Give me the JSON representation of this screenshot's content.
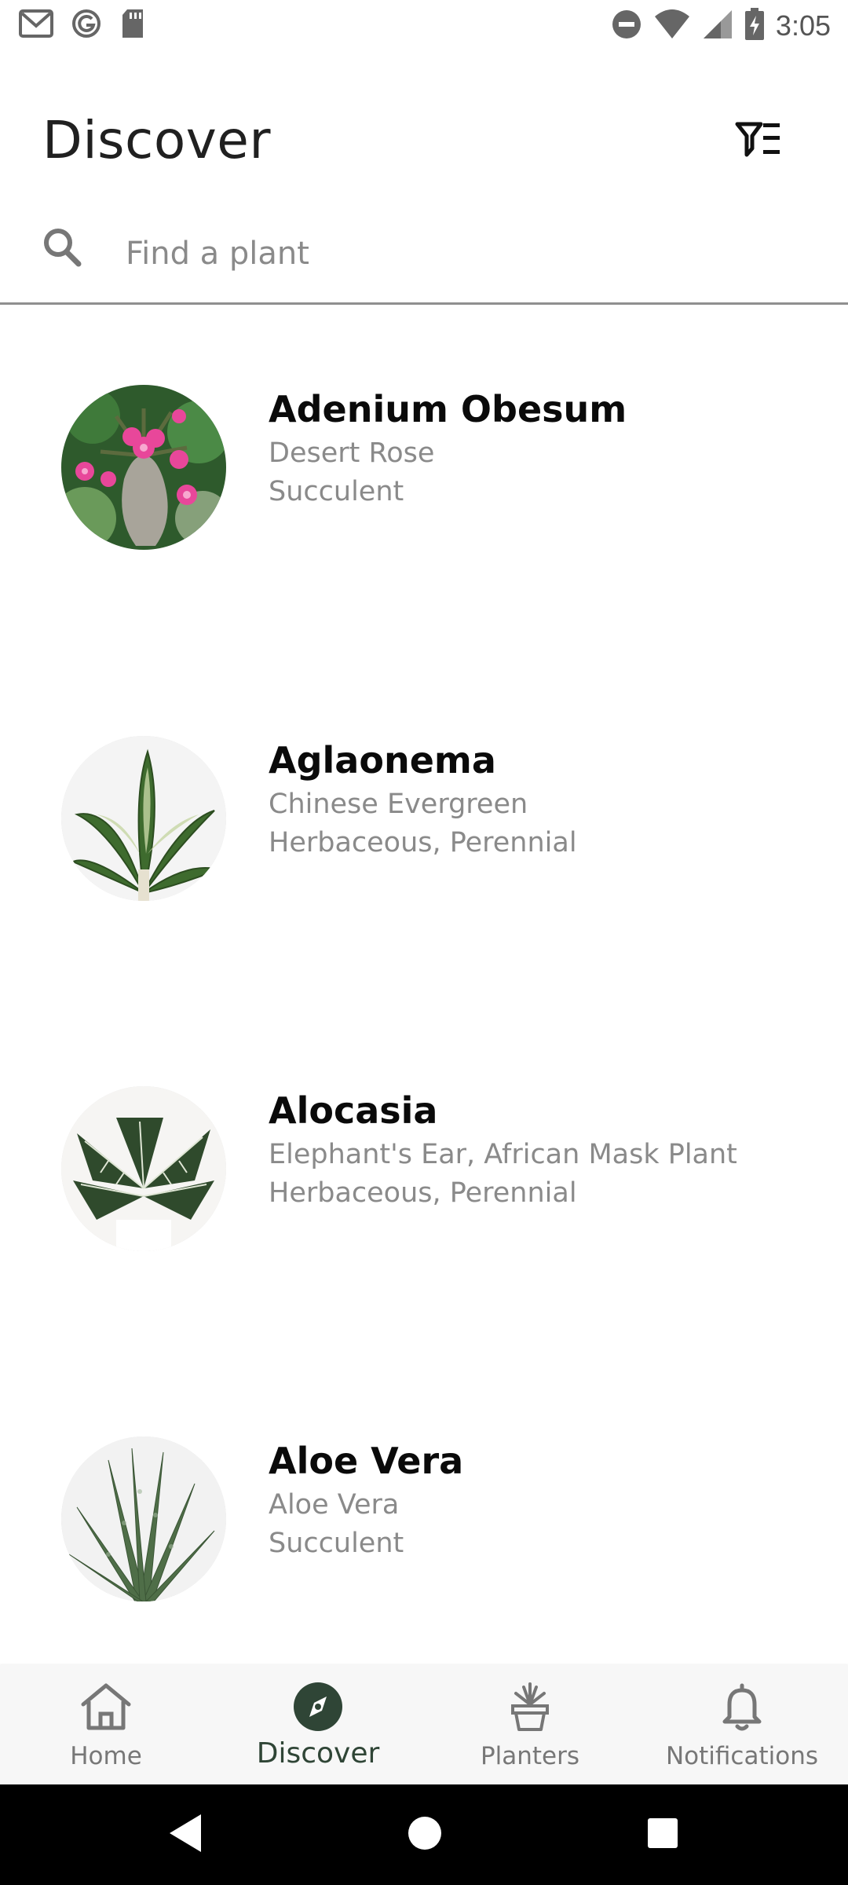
{
  "status_bar": {
    "time": "3:05",
    "left_icons": [
      "gmail-icon",
      "grammarly-icon",
      "sd-card-icon"
    ],
    "right_icons": [
      "dnd-icon",
      "wifi-icon",
      "signal-icon",
      "battery-charging-icon"
    ]
  },
  "header": {
    "title": "Discover",
    "filter_icon": "filter-list-icon"
  },
  "search": {
    "placeholder": "Find a plant",
    "value": ""
  },
  "plants": [
    {
      "name": "Adenium Obesum",
      "common_name": "Desert Rose",
      "type": "Succulent"
    },
    {
      "name": "Aglaonema",
      "common_name": "Chinese Evergreen",
      "type": "Herbaceous, Perennial"
    },
    {
      "name": "Alocasia",
      "common_name": "Elephant's Ear, African Mask Plant",
      "type": "Herbaceous, Perennial"
    },
    {
      "name": "Aloe Vera",
      "common_name": "Aloe Vera",
      "type": "Succulent"
    }
  ],
  "bottom_nav": {
    "items": [
      {
        "label": "Home",
        "icon": "home-icon",
        "active": false
      },
      {
        "label": "Discover",
        "icon": "compass-icon",
        "active": true
      },
      {
        "label": "Planters",
        "icon": "planter-icon",
        "active": false
      },
      {
        "label": "Notifications",
        "icon": "bell-icon",
        "active": false
      }
    ]
  },
  "colors": {
    "accent": "#2f4536",
    "secondary_text": "#8a8a8a",
    "nav_background": "#f7f7f7"
  }
}
